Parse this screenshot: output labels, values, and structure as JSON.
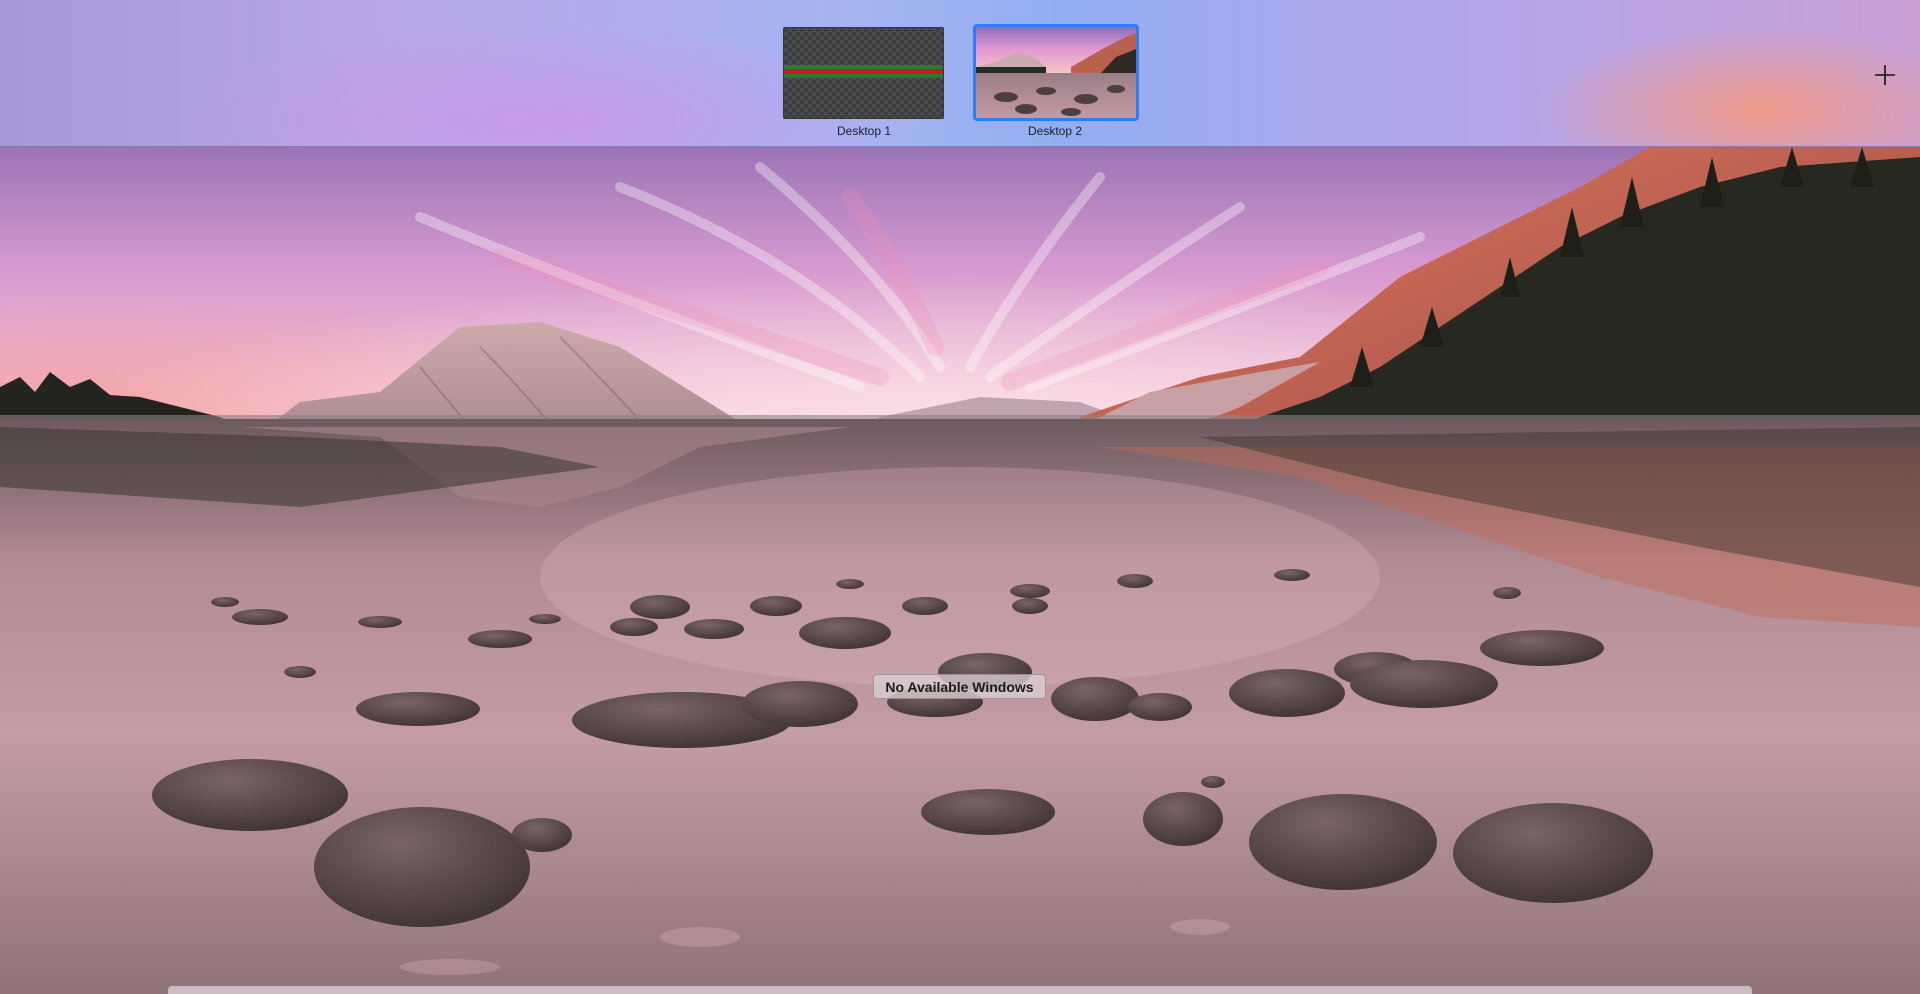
{
  "spaces_bar": {
    "desktops": [
      {
        "label": "Desktop 1",
        "wallpaper": "carbon-fiber-red-stripe",
        "active": false
      },
      {
        "label": "Desktop 2",
        "wallpaper": "mountain-lake-sunset",
        "active": true
      }
    ],
    "add_button_icon": "plus-icon"
  },
  "desktop_preview": {
    "wallpaper": "mountain-lake-sunset",
    "status_text": "No Available Windows"
  },
  "colors": {
    "selection_border": "#2f7cf6",
    "stripe_green": "#2a7a35",
    "stripe_red": "#c21d1d"
  }
}
